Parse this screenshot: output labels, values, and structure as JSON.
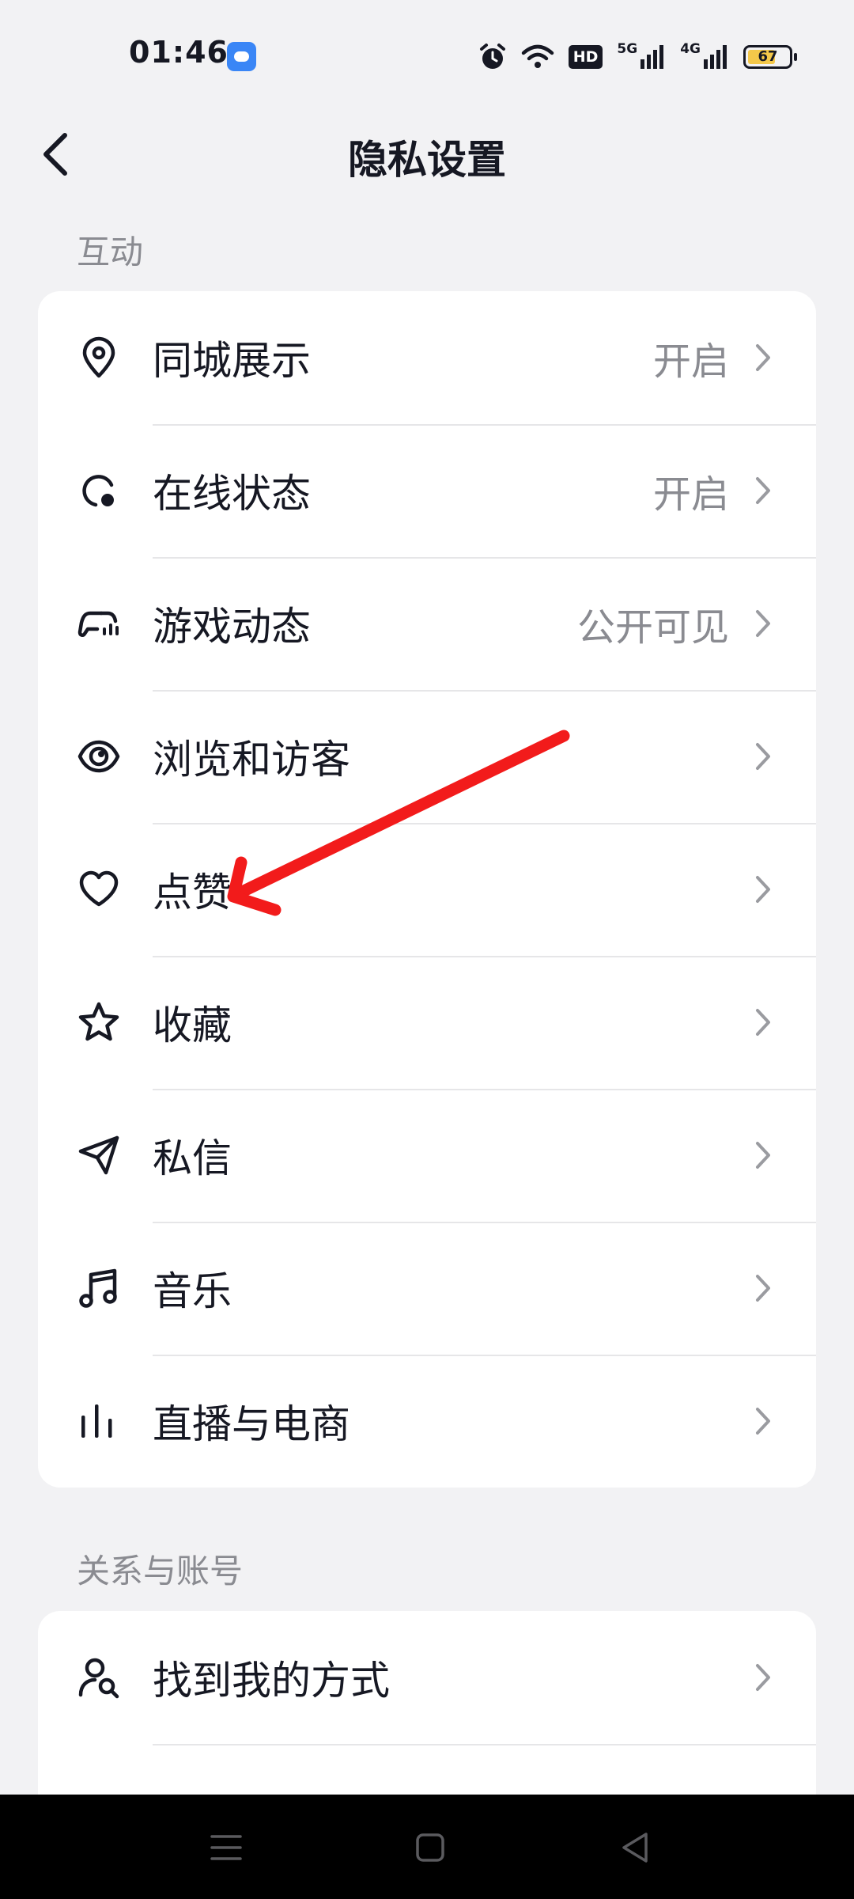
{
  "status_bar": {
    "time": "01:46",
    "hd_label": "HD",
    "sig1_label": "5G",
    "sig2_label": "4G",
    "battery_level": "67",
    "battery_fraction": 0.67,
    "battery_color": "#f4c84a"
  },
  "header": {
    "title": "隐私设置"
  },
  "sections": [
    {
      "title": "互动",
      "items": [
        {
          "label": "同城展示",
          "value": "开启",
          "icon": "location-pin-icon"
        },
        {
          "label": "在线状态",
          "value": "开启",
          "icon": "online-status-icon"
        },
        {
          "label": "游戏动态",
          "value": "公开可见",
          "icon": "gamepad-icon"
        },
        {
          "label": "浏览和访客",
          "value": "",
          "icon": "eye-icon"
        },
        {
          "label": "点赞",
          "value": "",
          "icon": "heart-icon"
        },
        {
          "label": "收藏",
          "value": "",
          "icon": "star-icon"
        },
        {
          "label": "私信",
          "value": "",
          "icon": "send-icon"
        },
        {
          "label": "音乐",
          "value": "",
          "icon": "music-note-icon"
        },
        {
          "label": "直播与电商",
          "value": "",
          "icon": "bars-icon"
        }
      ]
    },
    {
      "title": "关系与账号",
      "items": [
        {
          "label": "找到我的方式",
          "value": "",
          "icon": "user-search-icon"
        }
      ]
    }
  ],
  "annotation": {
    "color": "#f21b1b",
    "pointing_to": "点赞"
  }
}
